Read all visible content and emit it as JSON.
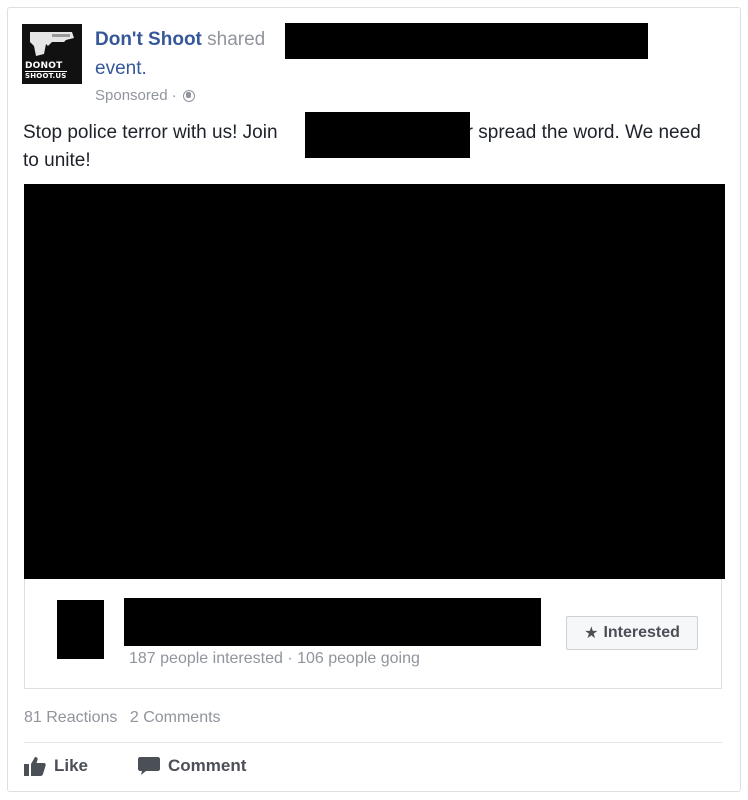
{
  "post": {
    "avatar_text_line1": "DONOT",
    "avatar_text_line2": "SHOOT.US",
    "page_name": "Don't Shoot",
    "shared_word": "shared",
    "event_word": "event.",
    "sponsored": "Sponsored ·",
    "text_before": "Stop police terror with us! Join",
    "text_after": "or spread the word. We need to unite!"
  },
  "event": {
    "stats": "187 people interested · 106 people going",
    "interested_button": "Interested",
    "star_icon": "star-icon"
  },
  "footer": {
    "reactions": "81 Reactions",
    "comments": "2 Comments",
    "like_label": "Like",
    "comment_label": "Comment"
  },
  "colors": {
    "link_blue": "#365899",
    "muted_gray": "#90949c",
    "redaction": "#000000"
  }
}
